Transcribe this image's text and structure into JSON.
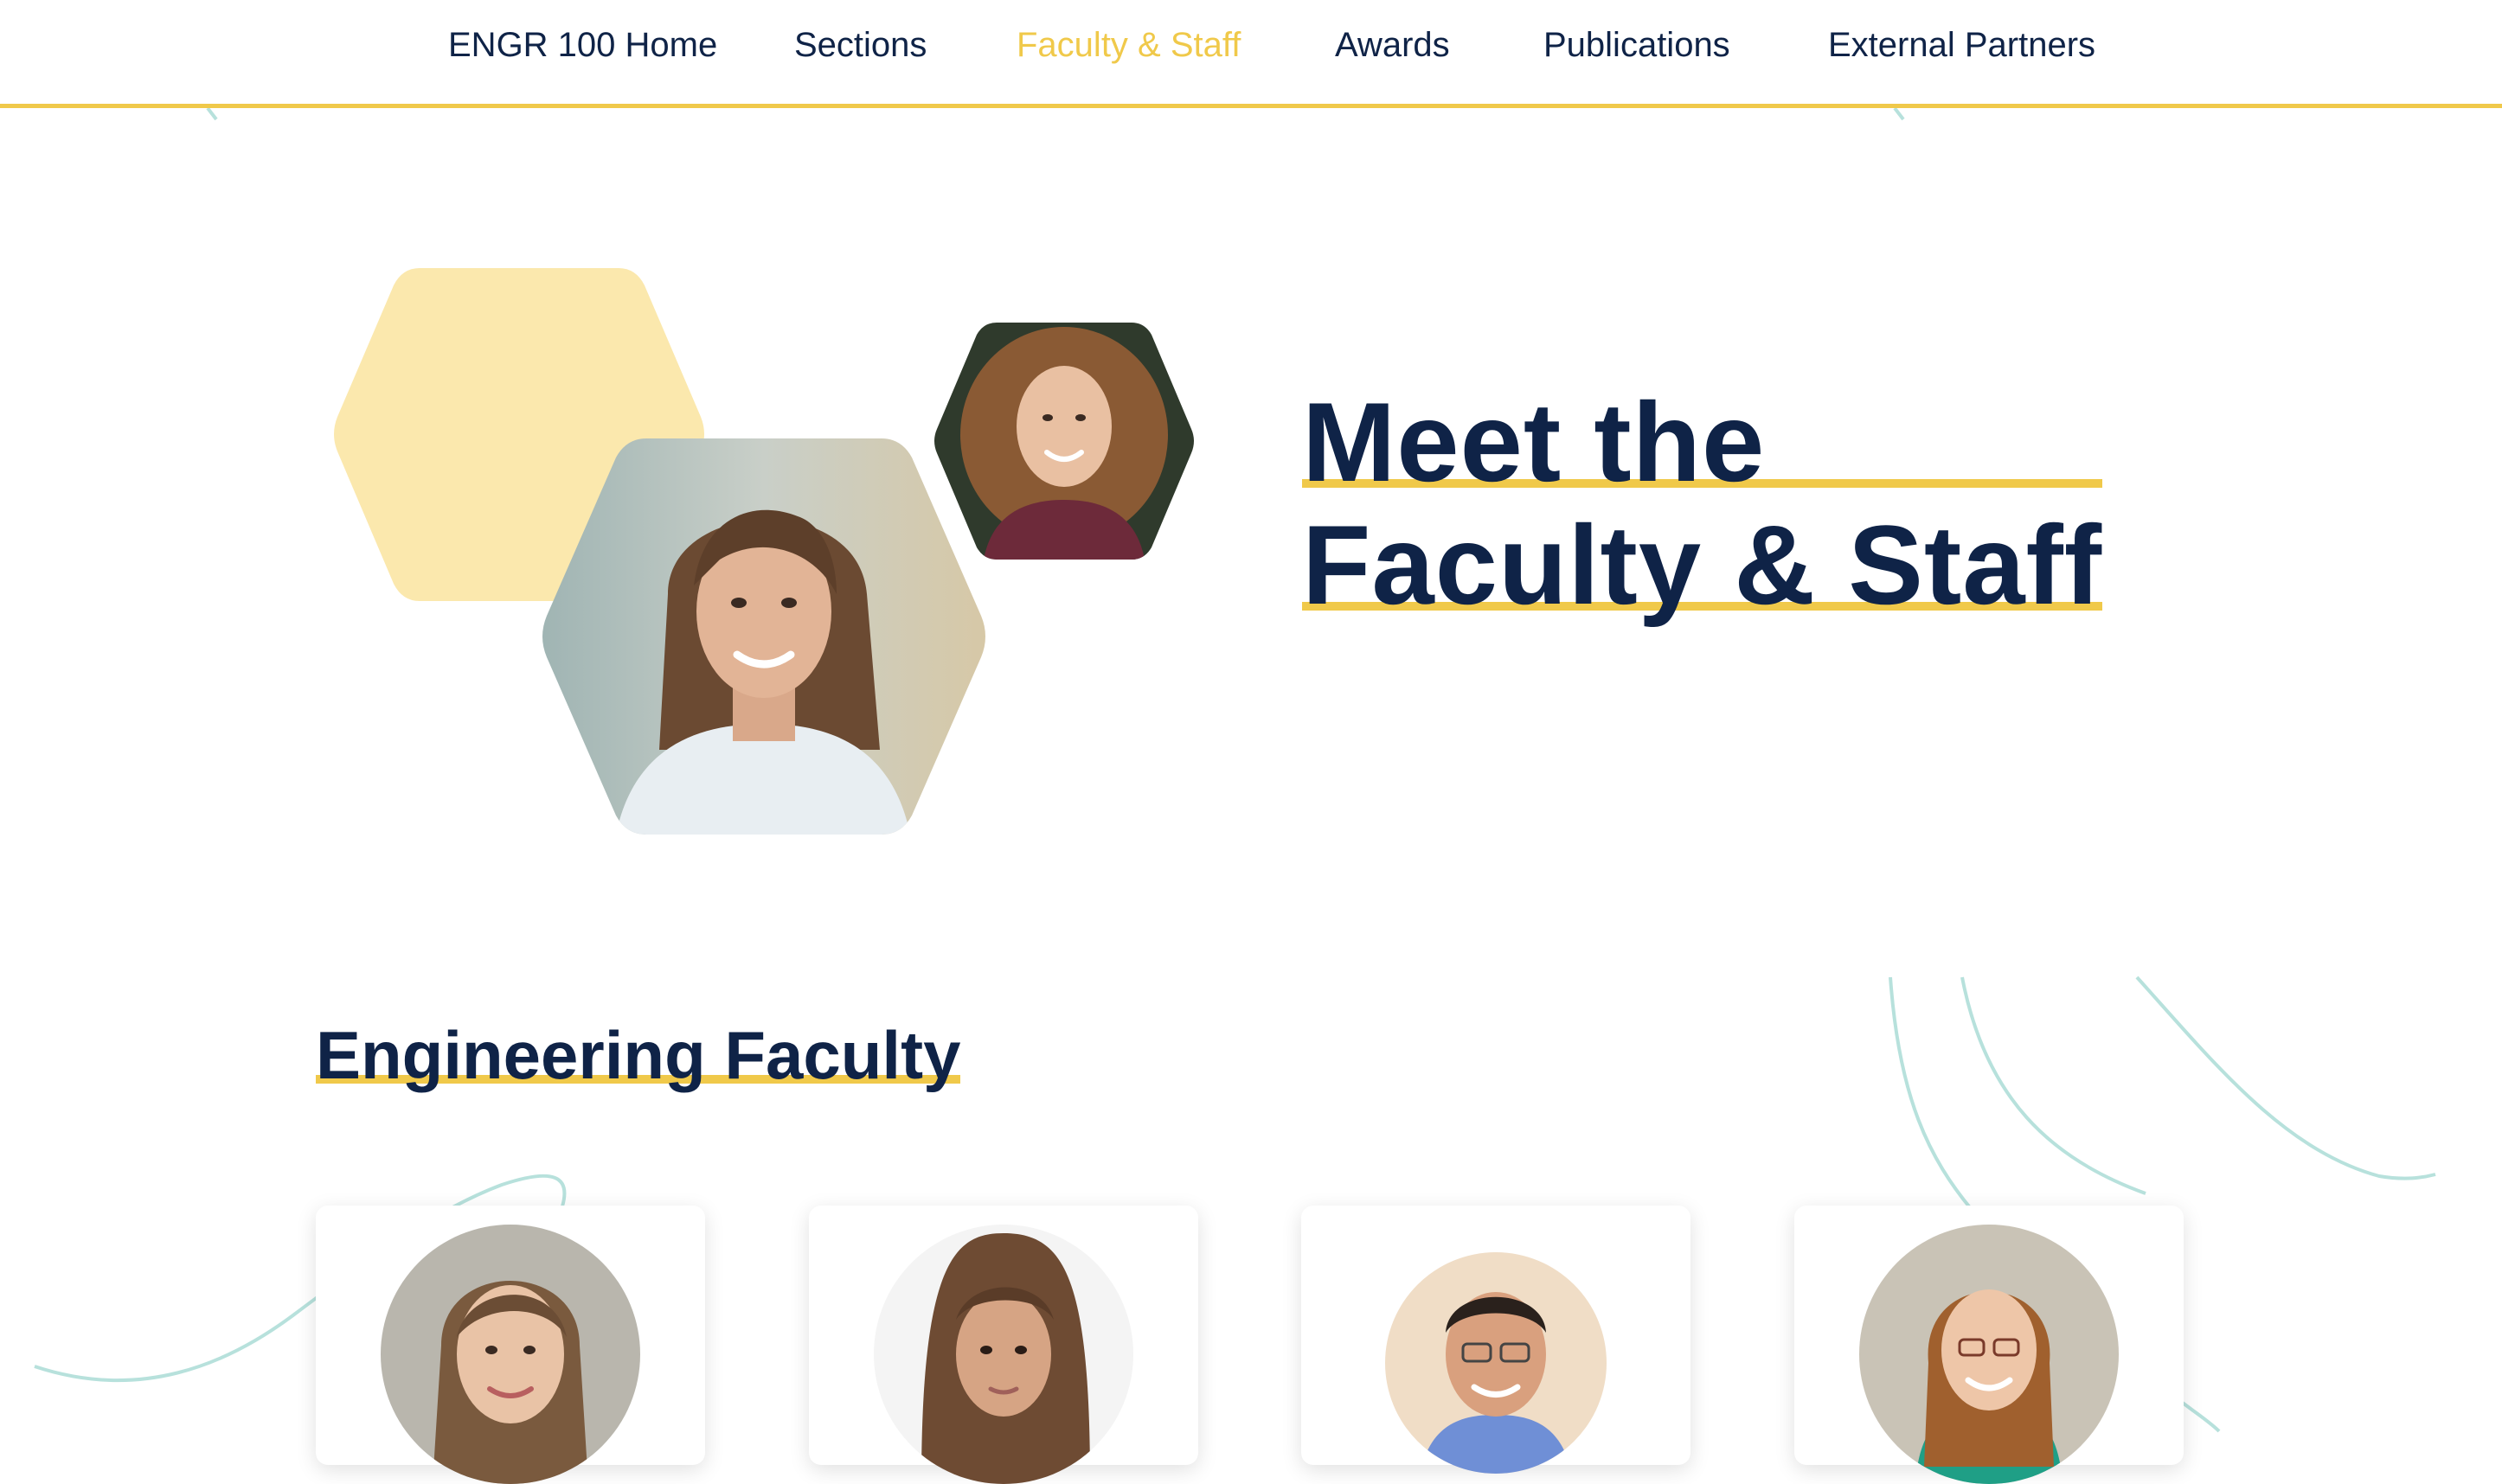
{
  "nav": {
    "items": [
      {
        "label": "ENGR 100 Home",
        "active": false
      },
      {
        "label": "Sections",
        "active": false
      },
      {
        "label": "Faculty & Staff",
        "active": true
      },
      {
        "label": "Awards",
        "active": false
      },
      {
        "label": "Publications",
        "active": false
      },
      {
        "label": "External Partners",
        "active": false
      }
    ]
  },
  "hero": {
    "title_line1": "Meet the",
    "title_line2": "Faculty & Staff"
  },
  "section": {
    "title": "Engineering Faculty"
  },
  "colors": {
    "navy": "#0f2347",
    "gold": "#f0c94a",
    "pale_gold": "#fbe8ad",
    "teal_line": "#b7e1dc"
  },
  "icons": [
    "faculty-portrait-photo",
    "staff-portrait-photo",
    "faculty-avatar-photo"
  ]
}
